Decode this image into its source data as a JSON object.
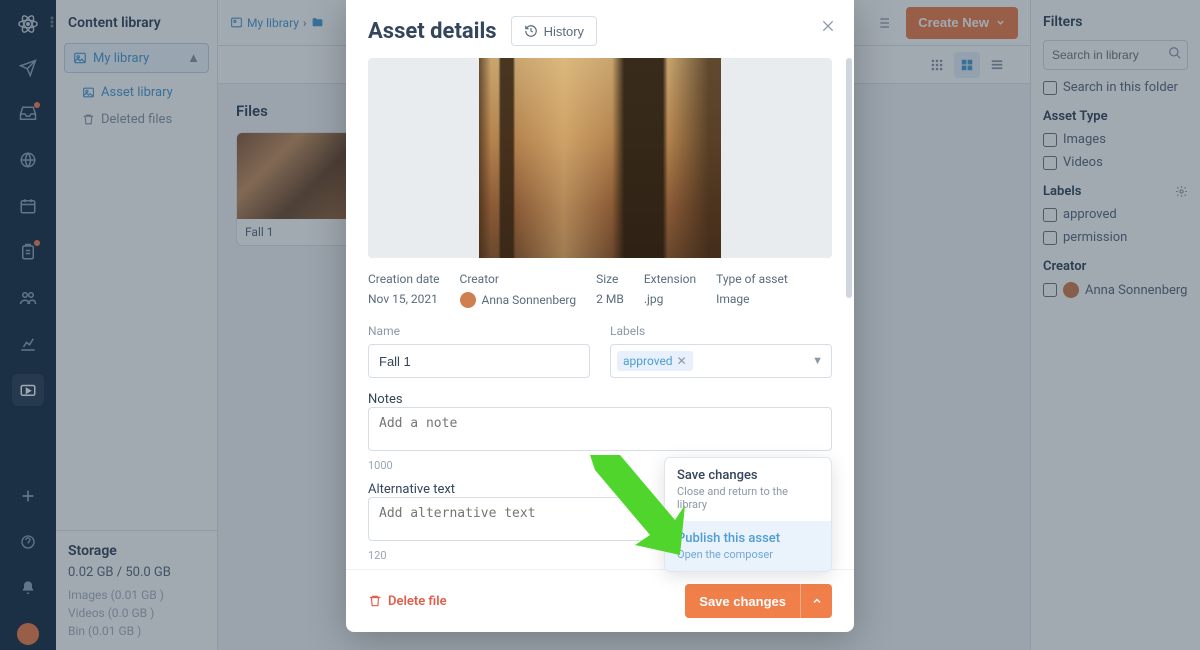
{
  "rail": {
    "icons": [
      "atom",
      "send",
      "inbox",
      "globe",
      "calendar",
      "clipboard",
      "people",
      "chart",
      "media"
    ]
  },
  "sidebar": {
    "title": "Content library",
    "root": "My library",
    "items": [
      {
        "label": "Asset library"
      },
      {
        "label": "Deleted files"
      }
    ],
    "storage": {
      "title": "Storage",
      "quota": "0.02 GB / 50.0 GB",
      "lines": [
        "Images (0.01 GB )",
        "Videos (0.0 GB )",
        "Bin (0.01 GB )"
      ]
    }
  },
  "topbar": {
    "crumb_root": "My library",
    "create_label": "Create New"
  },
  "content": {
    "files_heading": "Files",
    "tile_name": "Fall 1"
  },
  "filters": {
    "title": "Filters",
    "search_placeholder": "Search in library",
    "in_folder": "Search in this folder",
    "asset_type_label": "Asset Type",
    "type_images": "Images",
    "type_videos": "Videos",
    "labels_label": "Labels",
    "label_approved": "approved",
    "label_permission": "permission",
    "creator_label": "Creator",
    "creator_name": "Anna Sonnenberg"
  },
  "modal": {
    "title": "Asset details",
    "history": "History",
    "meta": {
      "creation_label": "Creation date",
      "creation_value": "Nov 15, 2021",
      "creator_label": "Creator",
      "creator_value": "Anna Sonnenberg",
      "size_label": "Size",
      "size_value": "2 MB",
      "ext_label": "Extension",
      "ext_value": ".jpg",
      "type_label": "Type of asset",
      "type_value": "Image"
    },
    "name_label": "Name",
    "name_value": "Fall 1",
    "labels_label": "Labels",
    "label_chip": "approved",
    "notes_label": "Notes",
    "notes_placeholder": "Add a note",
    "notes_counter": "1000",
    "alt_label": "Alternative text",
    "alt_placeholder": "Add alternative text",
    "alt_counter": "120",
    "delete": "Delete file",
    "save": "Save changes",
    "dropdown": {
      "opt1_title": "Save changes",
      "opt1_sub": "Close and return to the library",
      "opt2_title": "Publish this asset",
      "opt2_sub": "Open the composer"
    }
  }
}
